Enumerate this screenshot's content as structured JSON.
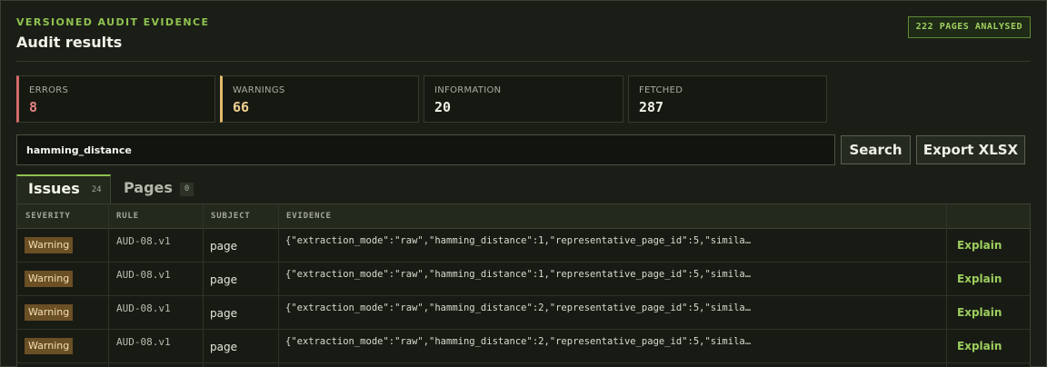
{
  "header": {
    "eyebrow": "VERSIONED AUDIT EVIDENCE",
    "title": "Audit results",
    "pages_badge": "222 PAGES ANALYSED"
  },
  "stats": {
    "errors": {
      "label": "ERRORS",
      "value": "8"
    },
    "warnings": {
      "label": "WARNINGS",
      "value": "66"
    },
    "information": {
      "label": "INFORMATION",
      "value": "20"
    },
    "fetched": {
      "label": "FETCHED",
      "value": "287"
    }
  },
  "search": {
    "value": "hamming_distance",
    "search_label": "Search",
    "export_label": "Export XLSX"
  },
  "tabs": [
    {
      "label": "Issues",
      "count": "24"
    },
    {
      "label": "Pages",
      "count": "0"
    }
  ],
  "table": {
    "columns": [
      "SEVERITY",
      "RULE",
      "SUBJECT",
      "EVIDENCE"
    ],
    "rows": [
      {
        "severity": "Warning",
        "rule": "AUD-08.v1",
        "subject": "page",
        "evidence": "{\"extraction_mode\":\"raw\",\"hamming_distance\":1,\"representative_page_id\":5,\"simila…",
        "action": "Explain"
      },
      {
        "severity": "Warning",
        "rule": "AUD-08.v1",
        "subject": "page",
        "evidence": "{\"extraction_mode\":\"raw\",\"hamming_distance\":1,\"representative_page_id\":5,\"simila…",
        "action": "Explain"
      },
      {
        "severity": "Warning",
        "rule": "AUD-08.v1",
        "subject": "page",
        "evidence": "{\"extraction_mode\":\"raw\",\"hamming_distance\":2,\"representative_page_id\":5,\"simila…",
        "action": "Explain"
      },
      {
        "severity": "Warning",
        "rule": "AUD-08.v1",
        "subject": "page",
        "evidence": "{\"extraction_mode\":\"raw\",\"hamming_distance\":2,\"representative_page_id\":5,\"simila…",
        "action": "Explain"
      }
    ]
  },
  "colors": {
    "accent": "#8fc24f",
    "error": "#d46a6a",
    "warning": "#e2b96a",
    "warning_badge_bg": "#6b4f25"
  }
}
